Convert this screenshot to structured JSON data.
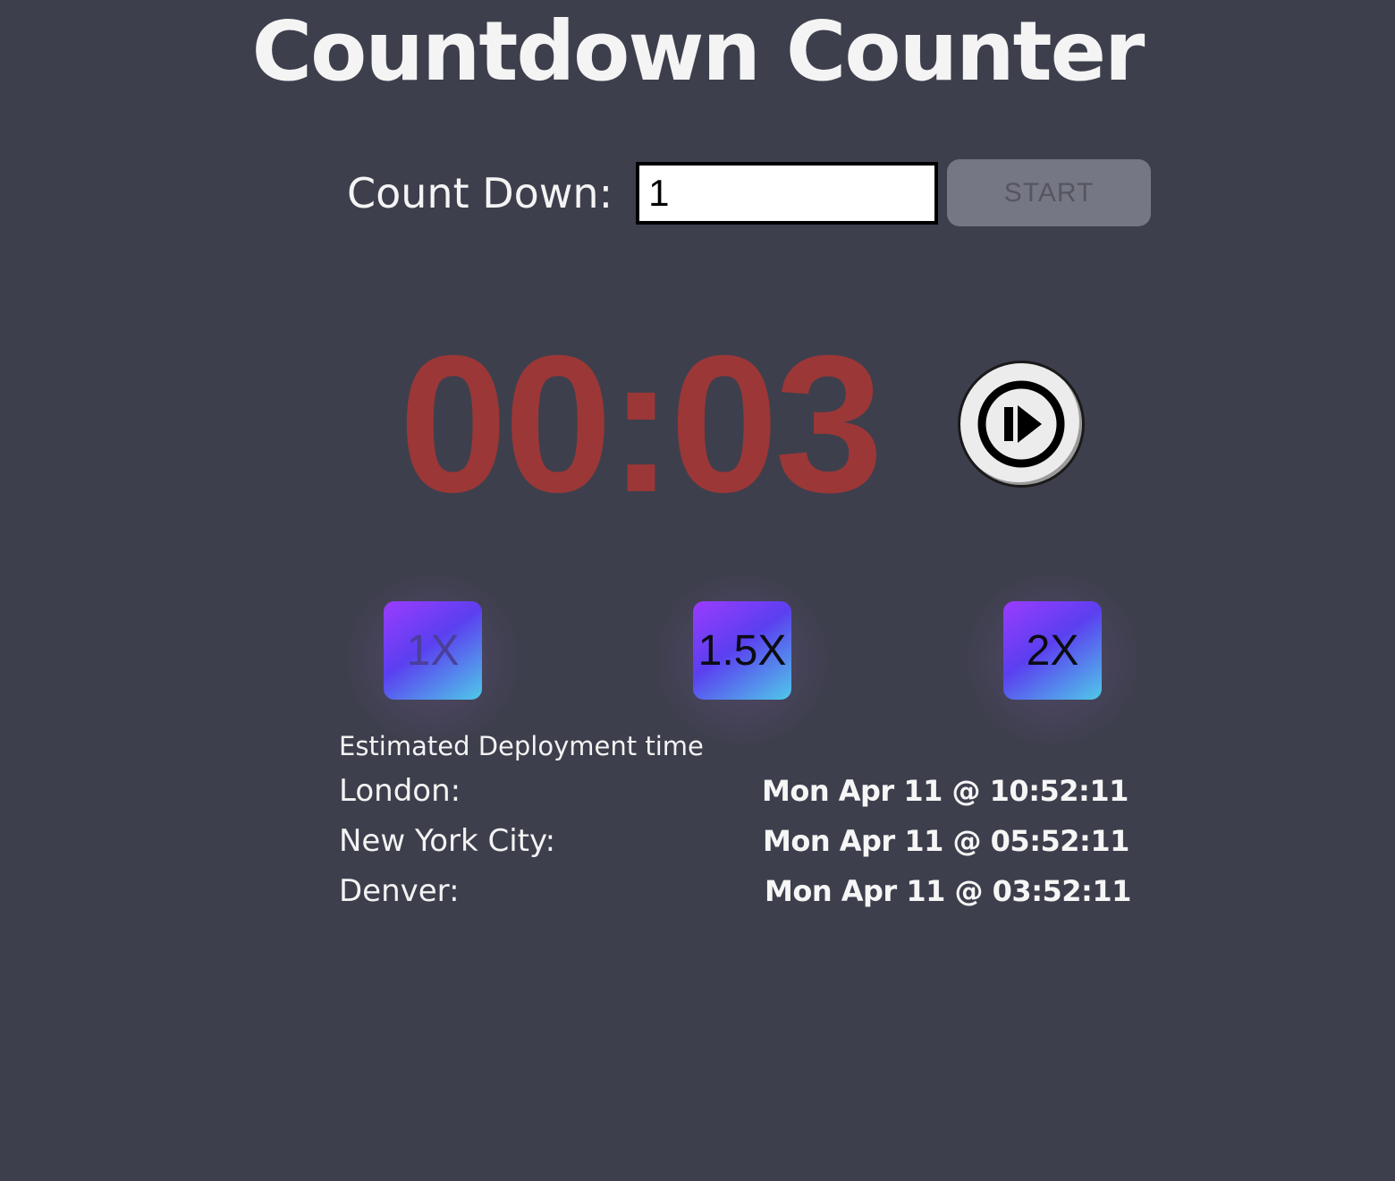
{
  "title": "Countdown Counter",
  "countdown": {
    "label": "Count Down:",
    "input_value": "1",
    "start_label": "START"
  },
  "timer": {
    "display": "00:03"
  },
  "controls": {
    "pause_icon": "play-pause-icon"
  },
  "speeds": [
    {
      "label": "1X"
    },
    {
      "label": "1.5X"
    },
    {
      "label": "2X"
    }
  ],
  "deployment": {
    "heading": "Estimated Deployment time",
    "rows": [
      {
        "city": "London:",
        "time": "Mon Apr 11 @ 10:52:11"
      },
      {
        "city": "New York City:",
        "time": "Mon Apr 11 @ 05:52:11"
      },
      {
        "city": "Denver:",
        "time": "Mon Apr 11 @ 03:52:11"
      }
    ]
  },
  "colors": {
    "background": "#3e3f4d",
    "timer": "#9b3737",
    "speed_gradient_start": "#9a3cff",
    "speed_gradient_end": "#4fc9e8"
  }
}
